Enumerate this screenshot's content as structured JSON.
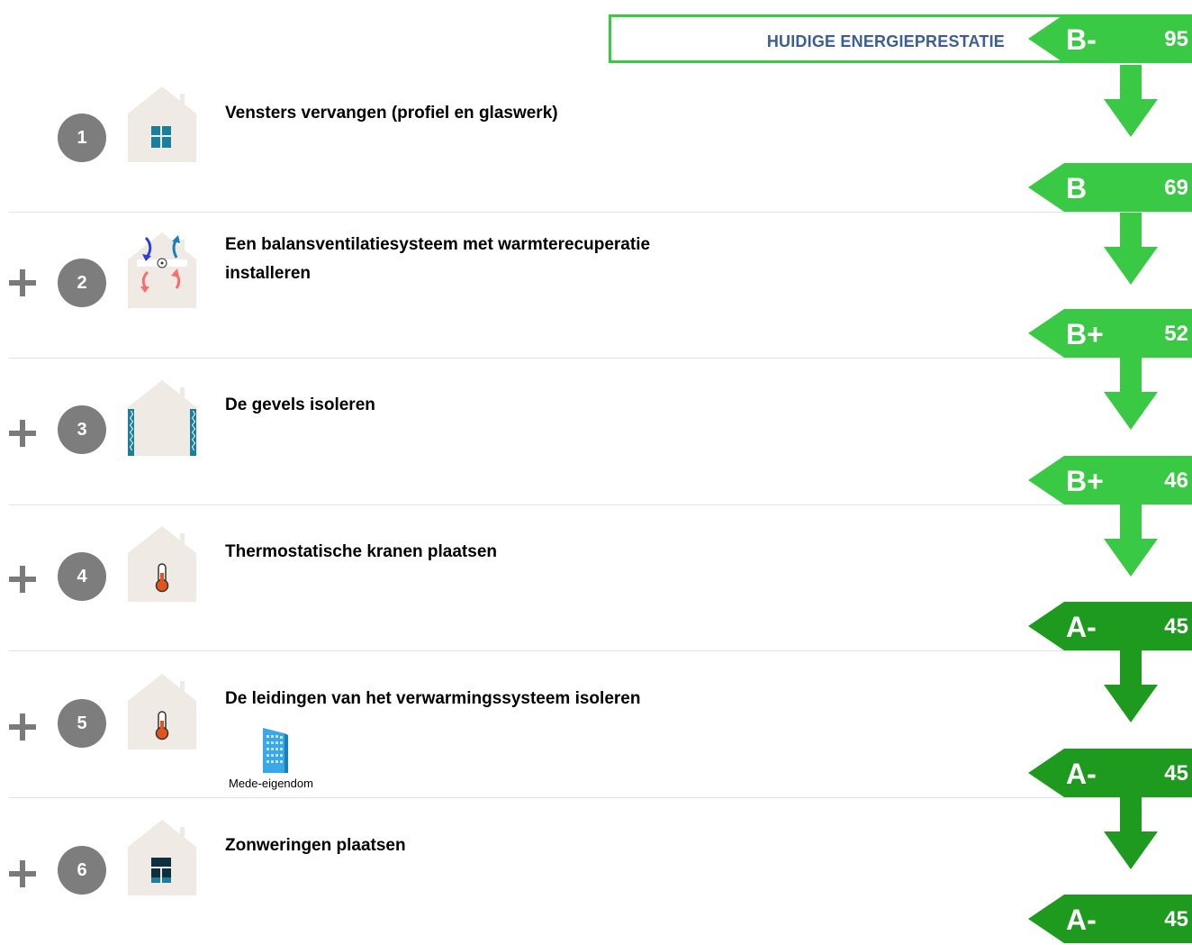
{
  "current": {
    "title": "HUIDIGE ENERGIEPRESTATIE",
    "label": {
      "class": "B-",
      "value": "95",
      "color": "#3ac944"
    }
  },
  "steps": [
    {
      "number": "1",
      "title": "Vensters vervangen (profiel en glaswerk)",
      "icon": "window-icon",
      "show_plus": false,
      "result": {
        "class": "B",
        "value": "69",
        "color": "#3ac944"
      }
    },
    {
      "number": "2",
      "title": "Een balansventilatiesysteem met warmterecuperatie installeren",
      "icon": "ventilation-icon",
      "show_plus": true,
      "result": {
        "class": "B+",
        "value": "52",
        "color": "#3ac944"
      }
    },
    {
      "number": "3",
      "title": "De gevels isoleren",
      "icon": "facade-insulation-icon",
      "show_plus": true,
      "result": {
        "class": "B+",
        "value": "46",
        "color": "#3ac944"
      }
    },
    {
      "number": "4",
      "title": "Thermostatische kranen plaatsen",
      "icon": "thermometer-icon",
      "show_plus": true,
      "result": {
        "class": "A-",
        "value": "45",
        "color": "#1e9a1e"
      }
    },
    {
      "number": "5",
      "title": "De leidingen van het verwarmingssysteem isoleren",
      "icon": "thermometer-icon",
      "show_plus": true,
      "co_ownership": "Mede-eigendom",
      "result": {
        "class": "A-",
        "value": "45",
        "color": "#1e9a1e"
      }
    },
    {
      "number": "6",
      "title": "Zonweringen plaatsen",
      "icon": "sunshade-window-icon",
      "show_plus": true,
      "result": {
        "class": "A-",
        "value": "45",
        "color": "#1e9a1e"
      }
    }
  ],
  "colors": {
    "light_green": "#3ac944",
    "dark_green": "#1e9a1e",
    "title_blue": "#3b5f95",
    "step_gray": "#7d7d7d"
  }
}
